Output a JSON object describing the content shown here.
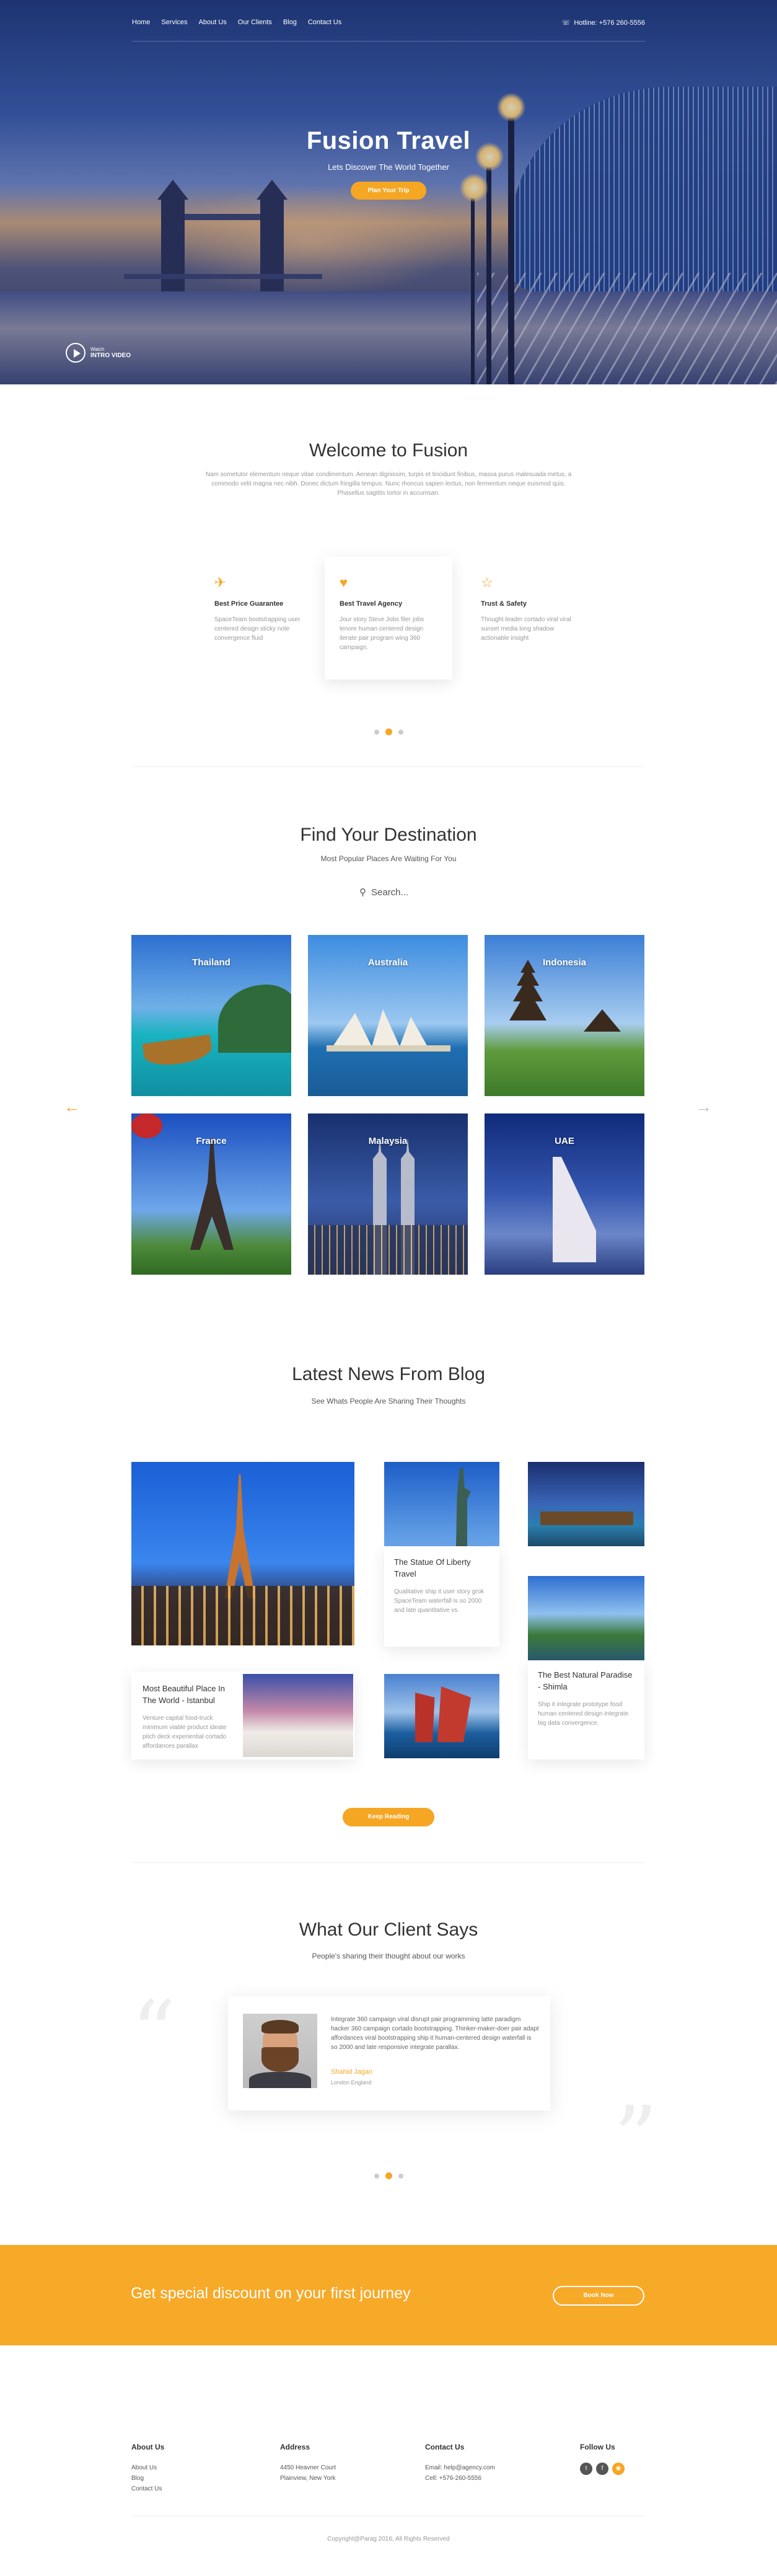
{
  "nav": {
    "items": [
      "Home",
      "Services",
      "About Us",
      "Our Clients",
      "Blog",
      "Contact Us"
    ],
    "hotline": "Hotline: +576 260-5556"
  },
  "hero": {
    "title": "Fusion Travel",
    "subtitle": "Lets Discover The World Together",
    "cta": "Plan Your Trip",
    "watch_small": "Watch",
    "watch_big": "INTRO VIDEO"
  },
  "welcome": {
    "title": "Welcome to Fusion",
    "text": "Nam sometutor elementum neque vitae condimentum. Aenean dignissim, turpis et tincidunt finibus, massa purus malesuada metus, a commodo velit magna nec nibh. Donec dictum fringilla tempus. Nunc rhoncus sapien lectus, non fermentum neque euismod quis. Phasellus sagittis tortor in accumsan.",
    "features": [
      {
        "icon": "plane-icon",
        "glyph": "✈",
        "title": "Best Price Guarantee",
        "text": "SpaceTeam bootstrapping user centered design sticky note convergence fluid"
      },
      {
        "icon": "heart-icon",
        "glyph": "♥",
        "title": "Best Travel Agency",
        "text": "Jour story Steve Jobs filer jobs lenore human centered design iterate pair program wing 360 campaign."
      },
      {
        "icon": "star-icon",
        "glyph": "☆",
        "title": "Trust & Safety",
        "text": "Thought leader cortado viral viral sunset media long shadow actionable insight"
      }
    ]
  },
  "destinations": {
    "title": "Find Your Destination",
    "subtitle": "Most Popular Places Are Waiting For You",
    "search_placeholder": "Search...",
    "items": [
      "Thailand",
      "Australia",
      "Indonesia",
      "France",
      "Malaysia",
      "UAE"
    ]
  },
  "blog": {
    "title": "Latest News From Blog",
    "subtitle": "See Whats People Are Sharing Their Thoughts",
    "posts": [
      {
        "title": "The Statue Of Liberty Travel",
        "text": "Qualitative ship it user story grok SpaceTeam waterfall is so 2000 and late quantitative vs."
      },
      {
        "title": "Most Beautiful Place In The World - Istanbul",
        "text": "Venture capital food-truck minimum viable product ideate pitch deck experiential cortado affordances parallax"
      },
      {
        "title": "The Best Natural Paradise - Shimla",
        "text": "Ship it integrate prototype food human centered design integrate big data convergence."
      }
    ],
    "button": "Keep Reading"
  },
  "testimonial": {
    "title": "What Our Client Says",
    "subtitle": "People's sharing their thought about our works",
    "text": "Integrate 360 campaign viral disrupt pair programming latte paradigm hacker 360 campaign cortado bootstrapping. Thinker-maker-doer pair adapt affordances viral bootstrapping ship it human-centered design waterfall is so 2000 and late responsive integrate parallax.",
    "name": "Shahid Jagan",
    "location": "London England"
  },
  "cta": {
    "text": "Get special discount on your first journey",
    "button": "Book Now"
  },
  "footer": {
    "about_title": "About Us",
    "about_links": [
      "About Us",
      "Blog",
      "Contact Us"
    ],
    "address_title": "Address",
    "address_lines": [
      "4450 Heavner Court",
      "Plainview, New York"
    ],
    "contact_title": "Contact Us",
    "contact_lines": [
      "Email: help@agency.com",
      "Cell: +576-260-5556"
    ],
    "follow_title": "Follow Us",
    "copyright": "Copyright@Parag 2016, All Rights Reserved"
  },
  "colors": {
    "accent": "#f5a623",
    "cta_bg": "#f7a928"
  }
}
